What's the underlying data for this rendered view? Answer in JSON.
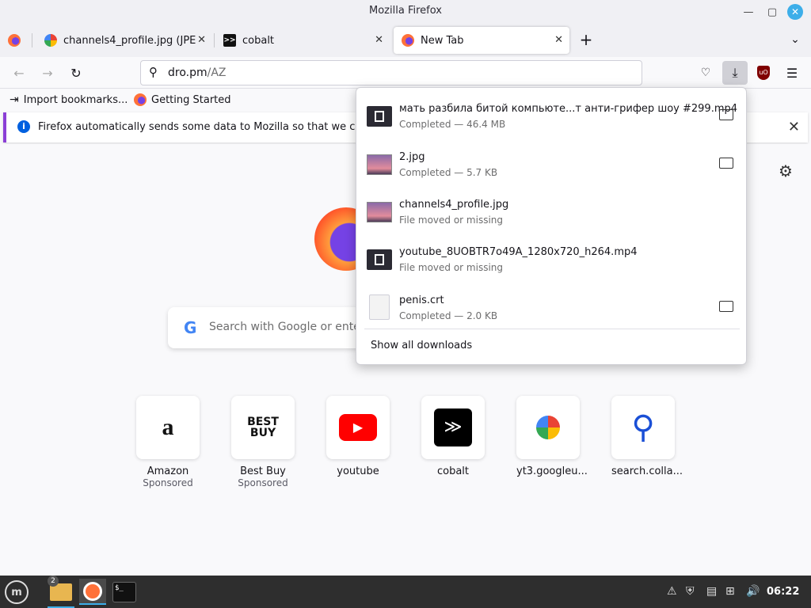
{
  "window": {
    "title": "Mozilla Firefox"
  },
  "tabs": [
    {
      "label": "channels4_profile.jpg (JPEG",
      "icon": "google-photos-icon"
    },
    {
      "label": "cobalt",
      "icon": "cobalt-icon"
    },
    {
      "label": "New Tab",
      "icon": "firefox-icon",
      "active": true
    }
  ],
  "urlbar": {
    "host": "dro.pm",
    "path": "/AZ"
  },
  "bookmarks": [
    {
      "label": "Import bookmarks...",
      "icon": "import-icon"
    },
    {
      "label": "Getting Started",
      "icon": "firefox-icon"
    }
  ],
  "notification": {
    "text": "Firefox automatically sends some data to Mozilla so that we can imp"
  },
  "search": {
    "placeholder": "Search with Google or ente"
  },
  "tiles": [
    {
      "label": "Amazon",
      "sub": "Sponsored"
    },
    {
      "label": "Best Buy",
      "sub": "Sponsored"
    },
    {
      "label": "youtube",
      "sub": ""
    },
    {
      "label": "cobalt",
      "sub": ""
    },
    {
      "label": "yt3.googleu...",
      "sub": ""
    },
    {
      "label": "search.colla...",
      "sub": ""
    }
  ],
  "downloads": {
    "items": [
      {
        "name": "мать разбила битой компьюте...т анти-грифер шоу #299.mp4",
        "status": "Completed — 46.4 MB",
        "type": "video",
        "folder": true
      },
      {
        "name": "2.jpg",
        "status": "Completed — 5.7 KB",
        "type": "image",
        "folder": true
      },
      {
        "name": "channels4_profile.jpg",
        "status": "File moved or missing",
        "type": "image",
        "folder": false
      },
      {
        "name": "youtube_8UOBTR7o49A_1280x720_h264.mp4",
        "status": "File moved or missing",
        "type": "video",
        "folder": false
      },
      {
        "name": "penis.crt",
        "status": "Completed — 2.0 KB",
        "type": "file",
        "folder": true
      }
    ],
    "show_all": "Show all downloads"
  },
  "taskbar": {
    "folder_badge": "2",
    "clock": "06:22"
  },
  "colors": {
    "accent": "#3daee9",
    "notification_bar": "#8b3fd6"
  }
}
